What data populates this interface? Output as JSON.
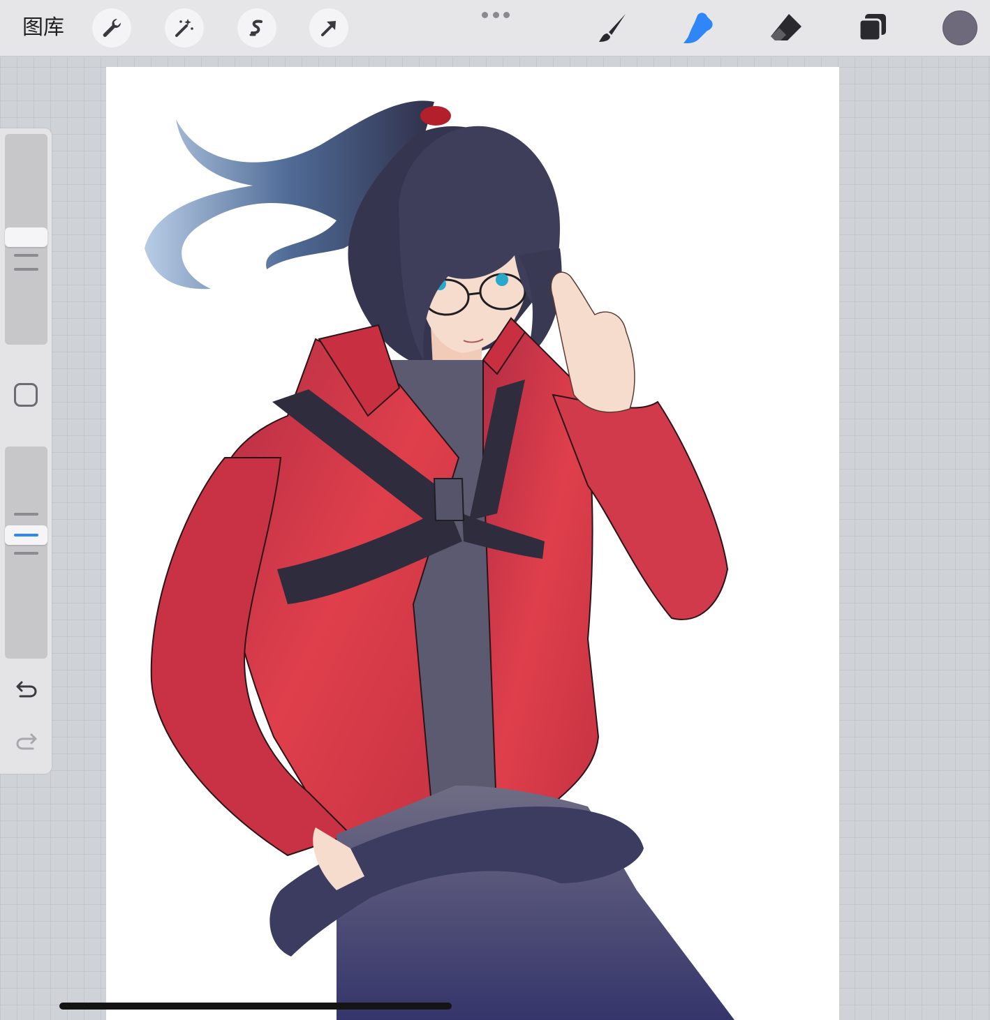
{
  "topbar": {
    "gallery_label": "图库",
    "left_tools": [
      "wrench-icon",
      "magic-wand-icon",
      "selection-icon",
      "transform-arrow-icon"
    ],
    "right_tools": [
      "brush-icon",
      "smudge-icon",
      "eraser-icon",
      "layers-icon"
    ],
    "active_tool": "smudge",
    "current_color": "#6e6a7b"
  },
  "colors": {
    "accent": "#2f86f6",
    "jacket": "#d63a49",
    "hair": "#3b3a56",
    "pants": "#4c4a6e"
  },
  "sidebar": {
    "brush_size_level": 0.5,
    "opacity_level": 0.42,
    "buttons": [
      "modify-square-icon",
      "undo-icon",
      "redo-icon"
    ]
  },
  "canvas": {
    "artwork": "illustration"
  }
}
